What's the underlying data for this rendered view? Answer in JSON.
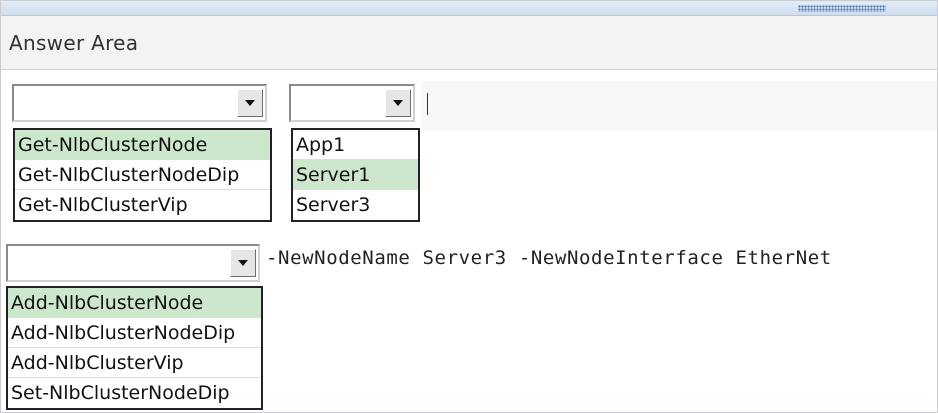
{
  "header": {
    "title": "Answer Area"
  },
  "row1": {
    "cmdlet_dropdown": {
      "value": "",
      "options": [
        {
          "label": "Get-NlbClusterNode",
          "highlighted": true
        },
        {
          "label": "Get-NlbClusterNodeDip",
          "highlighted": false
        },
        {
          "label": "Get-NlbClusterVip",
          "highlighted": false
        }
      ]
    },
    "server_dropdown": {
      "value": "",
      "options": [
        {
          "label": "App1",
          "highlighted": false
        },
        {
          "label": "Server1",
          "highlighted": true
        },
        {
          "label": "Server3",
          "highlighted": false
        }
      ]
    }
  },
  "row2": {
    "cmdlet_dropdown": {
      "value": "",
      "options": [
        {
          "label": "Add-NlbClusterNode",
          "highlighted": true
        },
        {
          "label": "Add-NlbClusterNodeDip",
          "highlighted": false
        },
        {
          "label": "Add-NlbClusterVip",
          "highlighted": false
        },
        {
          "label": "Set-NlbClusterNodeDip",
          "highlighted": false
        }
      ]
    },
    "parameters_text": "-NewNodeName Server3 -NewNodeInterface EtherNet"
  },
  "colors": {
    "highlight": "#cde7cd",
    "topbar": "#dbe7f3",
    "grip": "#4a6fae"
  }
}
